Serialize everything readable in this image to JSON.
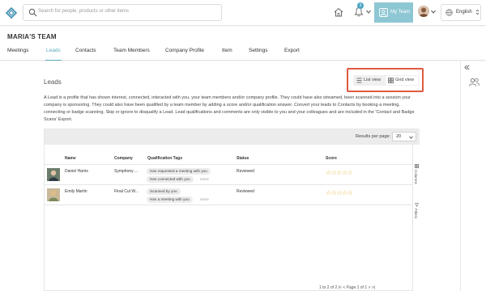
{
  "header": {
    "search_placeholder": "Search for people, products or other items",
    "notifications_count": "3",
    "my_team_label": "My Team",
    "language": "English"
  },
  "team": {
    "title": "MARIA'S TEAM",
    "tabs": [
      {
        "label": "Meetings",
        "active": false
      },
      {
        "label": "Leads",
        "active": true
      },
      {
        "label": "Contacts",
        "active": false
      },
      {
        "label": "Team Members",
        "active": false
      },
      {
        "label": "Company Profile",
        "active": false
      },
      {
        "label": "Item",
        "active": false
      },
      {
        "label": "Settings",
        "active": false
      },
      {
        "label": "Export",
        "active": false
      }
    ]
  },
  "leads": {
    "title": "Leads",
    "list_view_label": "List view",
    "grid_view_label": "Grid view",
    "description": "A Lead is a profile that has shown interest, connected, interacted with you, your team members and/or company profile. They could have also streamed, been scanned into a session your company is sponsoring. They could also have been qualified by a team member by adding a score and/or qualification answer. Convert your leads to Contacts by booking a meeting, connecting or badge scanning. Skip or ignore to disqualify a Lead. Lead qualifications and comments are only visible to you and your colleagues and are included in the 'Contact and Badge Scans' Export.",
    "results_per_page_label": "Results per page:",
    "results_per_page_value": "20",
    "columns": {
      "name": "Name",
      "company": "Company",
      "tags": "Qualification Tags",
      "status": "Status",
      "score": "Score"
    },
    "rows": [
      {
        "name": "Daniel Harris",
        "company": "Symphony ...",
        "tags": [
          "Has requested a meeting with you",
          "Has connected with you"
        ],
        "more": "more",
        "status": "Reviewed",
        "score": 0
      },
      {
        "name": "Emily Martin",
        "company": "Final Cut W...",
        "tags": [
          "Scanned by you",
          "Has a meeting with you"
        ],
        "more": "more",
        "status": "Reviewed",
        "score": 0
      }
    ],
    "columns_side_label": "Columns",
    "filters_side_label": "Filters",
    "pager_text": "1 to 2 of 2     |<   <   Page 1 of 1   >   >|"
  },
  "colors": {
    "accent": "#5aa9bd",
    "highlight_box": "#e05a3f",
    "star": "#e0b22a"
  }
}
